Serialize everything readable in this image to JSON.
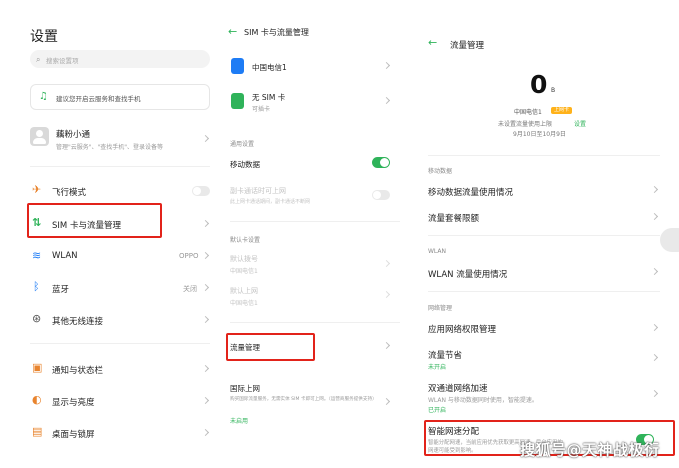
{
  "left": {
    "title": "设置",
    "search_placeholder": "搜索设置项",
    "notice": "建议您开启云服务和查找手机",
    "account_name": "藕粉小通",
    "account_sub": "管理\"云服务\"、\"查找手机\"、登录设备等",
    "items": [
      {
        "label": "飞行模式",
        "value": ""
      },
      {
        "label": "SIM 卡与流量管理",
        "value": ""
      },
      {
        "label": "WLAN",
        "value": "OPPO"
      },
      {
        "label": "蓝牙",
        "value": "关闭"
      },
      {
        "label": "其他无线连接",
        "value": ""
      },
      {
        "label": "通知与状态栏",
        "value": ""
      },
      {
        "label": "显示与亮度",
        "value": ""
      },
      {
        "label": "桌面与锁屏",
        "value": ""
      }
    ]
  },
  "middle": {
    "title": "SIM 卡与流量管理",
    "sim1": "中国电信1",
    "sim2": "无 SIM 卡",
    "sim2_sub": "可插卡",
    "section_general": "通用设置",
    "mobile_data": "移动数据",
    "dual_data": "副卡通话时可上网",
    "dual_data_sub": "此上网卡通话期间，副卡通话不断网",
    "section_default": "默认卡设置",
    "default_call": "默认拨号",
    "default_call_value": "中国电信1",
    "default_data": "默认上网",
    "default_data_value": "中国电信1",
    "traffic": "流量管理",
    "roaming": "国际上网",
    "roaming_sub": "购买国际流量服务，无需实体 SIM 卡即可上网。（运营商服务提供支持）",
    "roaming_status": "未启用"
  },
  "right": {
    "title": "流量管理",
    "usage_value": "0",
    "usage_unit": "B",
    "carrier": "中国电信1",
    "carrier_badge": "上网卡",
    "no_limit": "未设置流量使用上限",
    "set_link": "设置",
    "period": "9月10日至10月9日",
    "section_mobile": "移动数据",
    "mobile_usage": "移动数据流量使用情况",
    "plan_limit": "流量套餐限额",
    "section_wlan": "WLAN",
    "wlan_usage": "WLAN 流量使用情况",
    "section_network": "网络管理",
    "app_permission": "应用网络权限管理",
    "saver": "流量节省",
    "saver_status": "未开启",
    "dual_channel": "双通道网络加速",
    "dual_channel_sub": "WLAN 与移动数据同时使用，智能提速。",
    "dual_channel_status": "已开启",
    "smart_alloc": "智能网速分配",
    "smart_alloc_sub1": "智能分配网速，当前应用优先获取更高网速，后台应用的",
    "smart_alloc_sub2": "网速可能受到影响。"
  },
  "watermark": "搜狐号@天神战极衍",
  "colors": {
    "accent": "#2fb35a",
    "highlight": "#e2231a",
    "sim_blue": "#1e7cf5",
    "sim_green": "#2fb35a"
  }
}
